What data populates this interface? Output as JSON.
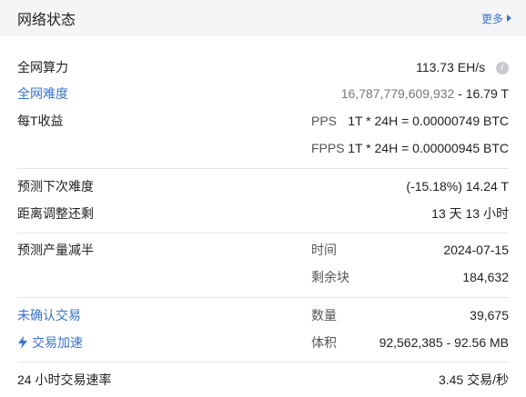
{
  "header": {
    "title": "网络状态",
    "more_label": "更多"
  },
  "hashrate": {
    "label": "全网算力",
    "value": "113.73 EH/s"
  },
  "difficulty": {
    "label": "全网难度",
    "value_full": "16,787,779,609,932",
    "separator": " - ",
    "value_short": "16.79 T"
  },
  "earnings": {
    "label": "每T收益",
    "pps_label": "PPS",
    "pps_value": "1T * 24H = 0.00000749 BTC",
    "fpps_label": "FPPS",
    "fpps_value": "1T * 24H = 0.00000945 BTC"
  },
  "next_difficulty": {
    "label": "预测下次难度",
    "value": "(-15.18%) 14.24 T"
  },
  "adjust_remaining": {
    "label": "距离调整还剩",
    "value": "13 天 13 小时"
  },
  "halving": {
    "label": "预测产量减半",
    "time_label": "时间",
    "time_value": "2024-07-15",
    "blocks_label": "剩余块",
    "blocks_value": "184,632"
  },
  "unconfirmed": {
    "label": "未确认交易",
    "count_label": "数量",
    "count_value": "39,675",
    "accelerate_label": "交易加速",
    "size_label": "体积",
    "size_value": "92,562,385 - 92.56 MB"
  },
  "tx_rate": {
    "label": "24 小时交易速率",
    "value": "3.45 交易/秒"
  },
  "colors": {
    "link": "#3a73c8",
    "header_bg": "#f4f5f7"
  },
  "icons": {
    "info": "info-icon",
    "more": "caret-right-icon",
    "accelerate": "lightning-icon"
  }
}
